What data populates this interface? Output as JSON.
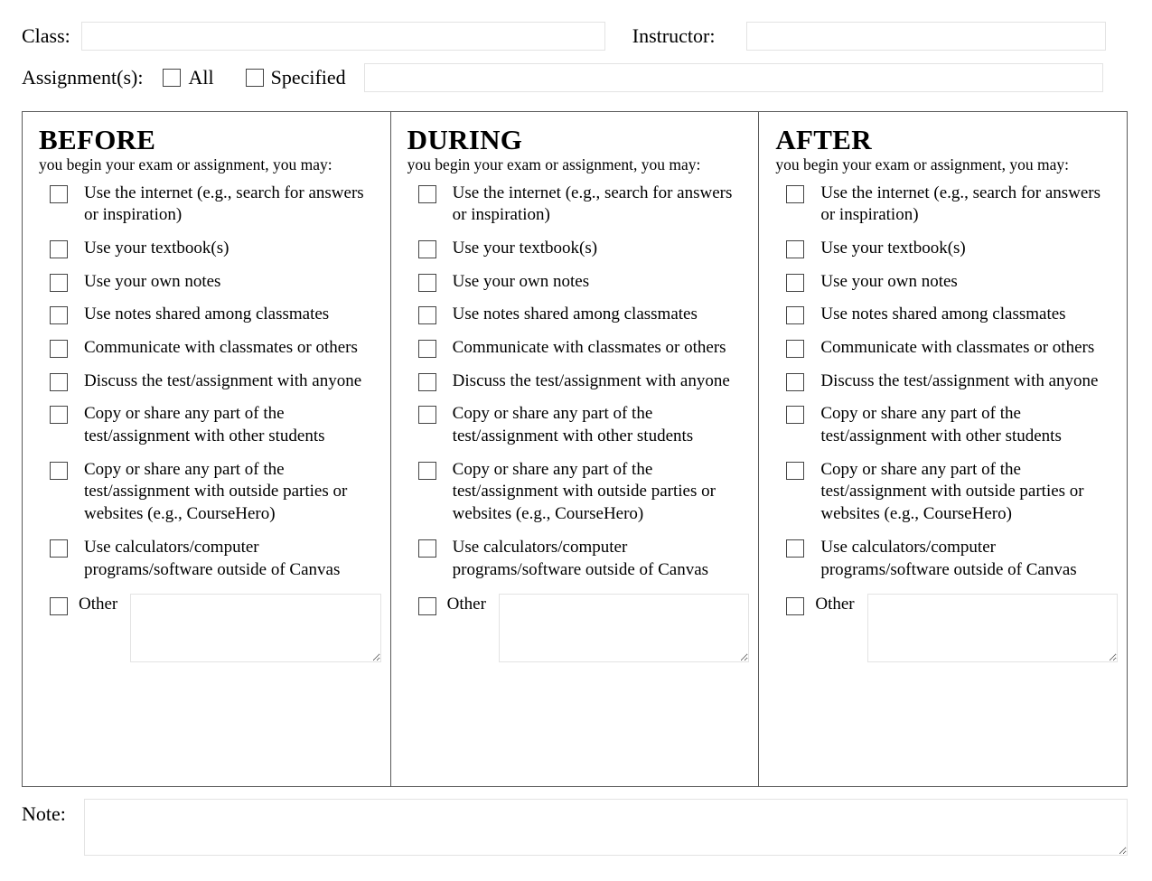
{
  "header": {
    "class_label": "Class:",
    "class_value": "",
    "class_placeholder": "",
    "instructor_label": "Instructor:",
    "instructor_value": "",
    "instructor_placeholder": "",
    "assignments_label": "Assignment(s):",
    "all_label": "All",
    "all_checked": false,
    "specified_label": "Specified",
    "specified_checked": false,
    "assignments_value": "",
    "assignments_placeholder": ""
  },
  "matrix": {
    "subtitle": "you begin your exam or assignment, you may:",
    "other_label": "Other",
    "options": [
      "Use the internet (e.g., search for answers or inspiration)",
      "Use your textbook(s)",
      "Use your own notes",
      "Use notes shared among classmates",
      "Communicate with classmates or others",
      "Discuss the test/assignment with anyone",
      "Copy or share any part of the test/assignment with other students",
      "Copy or share any part of the test/assignment with outside parties or websites (e.g., CourseHero)",
      "Use calculators/computer programs/software outside of Canvas"
    ],
    "columns": [
      {
        "title": "BEFORE",
        "other_value": ""
      },
      {
        "title": "DURING",
        "other_value": ""
      },
      {
        "title": "AFTER",
        "other_value": ""
      }
    ]
  },
  "note": {
    "label": "Note:",
    "value": "",
    "placeholder": ""
  },
  "colors": {
    "page_background": "#ffffff",
    "text": "#000000",
    "table_border": "#5a5a5a",
    "input_border": "#e3e3e3",
    "checkbox_border": "#444444"
  }
}
